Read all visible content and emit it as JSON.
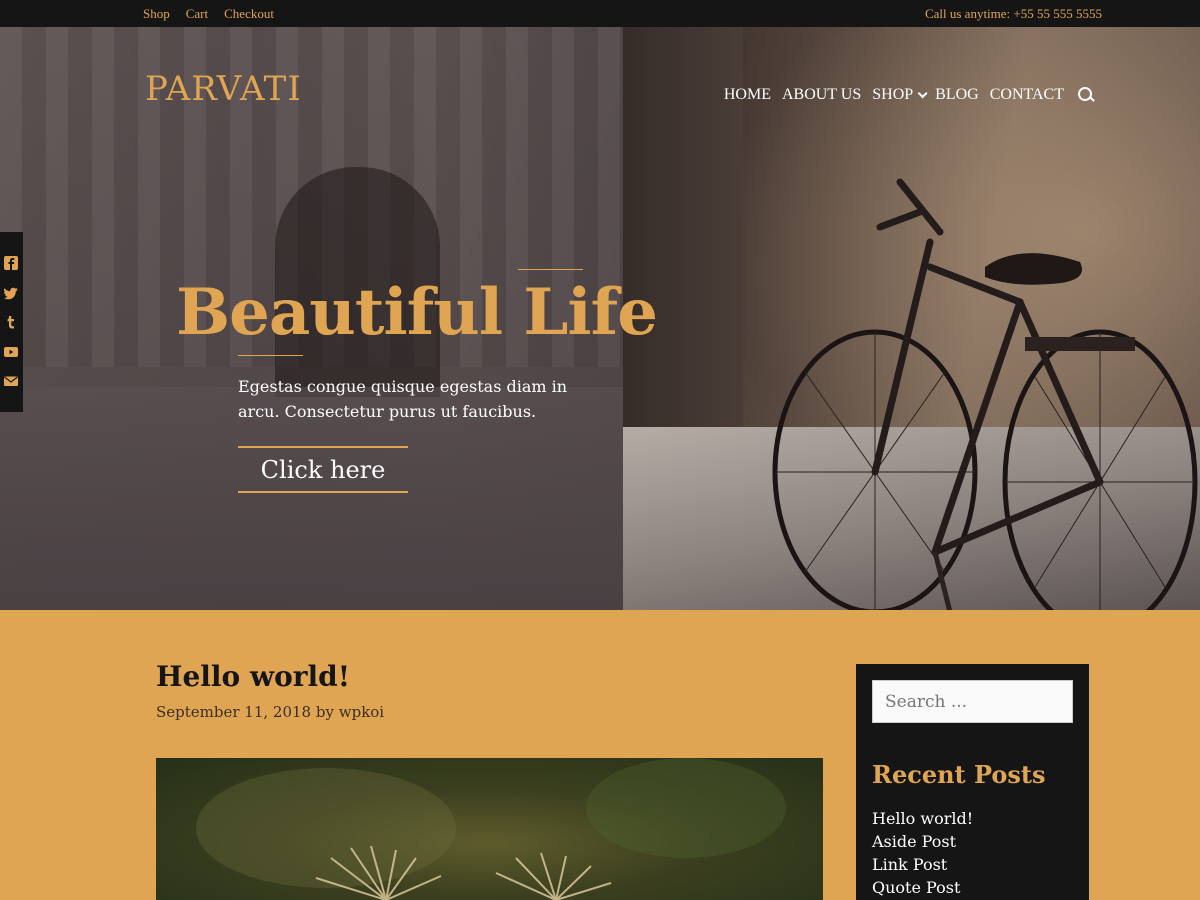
{
  "topbar": {
    "links": [
      "Shop",
      "Cart",
      "Checkout"
    ],
    "phone": "Call us anytime: +55 55 555 5555"
  },
  "header": {
    "logo": "PARVATI",
    "nav": [
      "HOME",
      "ABOUT US",
      "SHOP",
      "BLOG",
      "CONTACT"
    ]
  },
  "social": [
    "facebook-icon",
    "twitter-icon",
    "tumblr-icon",
    "youtube-icon",
    "email-icon"
  ],
  "hero": {
    "title": "Beautiful Life",
    "text": "Egestas congue quisque egestas diam in arcu. Consectetur purus ut faucibus.",
    "button": "Click here"
  },
  "post": {
    "title": "Hello world!",
    "date": "September 11, 2018",
    "by": "by",
    "author": "wpkoi"
  },
  "sidebar": {
    "search_placeholder": "Search ...",
    "recent_title": "Recent Posts",
    "recent_posts": [
      "Hello world!",
      "Aside Post",
      "Link Post",
      "Quote Post"
    ]
  },
  "colors": {
    "accent": "#e0a553",
    "dark": "#151515"
  }
}
